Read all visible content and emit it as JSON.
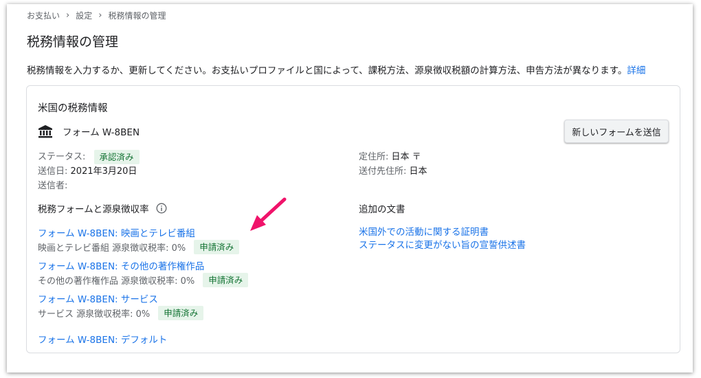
{
  "breadcrumb": [
    "お支払い",
    "設定",
    "税務情報の管理"
  ],
  "page_title": "税務情報の管理",
  "intro": {
    "text": "税務情報を入力するか、更新してください。お支払いプロファイルと国によって、課税方法、源泉徴収税額の計算方法、申告方法が異なります。",
    "link": "詳細"
  },
  "card": {
    "title": "米国の税務情報",
    "form_icon": "bank-icon",
    "form_name": "フォーム W-8BEN",
    "new_form_button": "新しいフォームを送信",
    "status_label": "ステータス:",
    "status_value": "承認済み",
    "sent_date_label": "送信日:",
    "sent_date_value": "2021年3月20日",
    "sender_label": "送信者:",
    "residence_label": "定住所:",
    "residence_value": "日本 〒",
    "mailing_label": "送付先住所:",
    "mailing_value": "日本",
    "forms_heading": "税務フォームと源泉徴収率",
    "info_icon": "info-icon",
    "forms": [
      {
        "link": "フォーム W-8BEN: 映画とテレビ番組",
        "rate": "映画とテレビ番組 源泉徴収税率: 0%",
        "badge": "申請済み"
      },
      {
        "link": "フォーム W-8BEN: その他の著作権作品",
        "rate": "その他の著作権作品 源泉徴収税率: 0%",
        "badge": "申請済み"
      },
      {
        "link": "フォーム W-8BEN: サービス",
        "rate": "サービス 源泉徴収税率: 0%",
        "badge": "申請済み"
      },
      {
        "link": "フォーム W-8BEN: デフォルト"
      }
    ],
    "docs_heading": "追加の文書",
    "docs": [
      "米国外での活動に関する証明書",
      "ステータスに変更がない旨の宣誓供述書"
    ]
  },
  "colors": {
    "link": "#1a73e8",
    "badge_bg": "#e6f4ea",
    "badge_text": "#137333",
    "arrow": "#f0136a"
  }
}
